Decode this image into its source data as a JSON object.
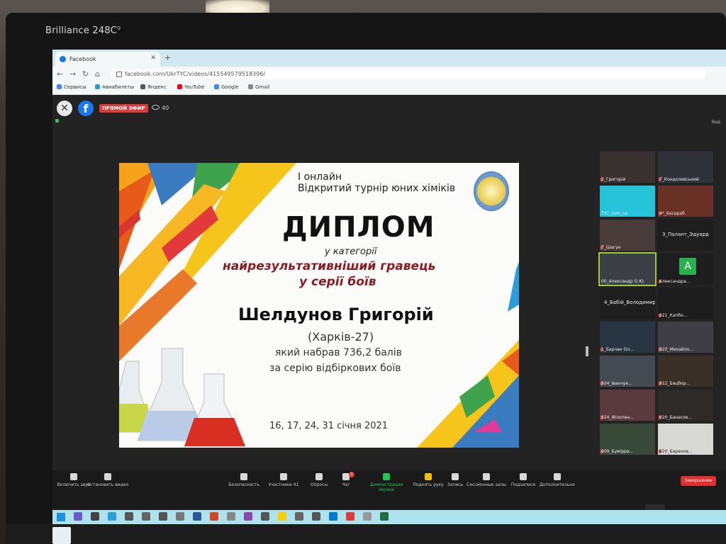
{
  "monitor": {
    "brand": "Brilliance 248C",
    "brand_sup": "Q"
  },
  "browser": {
    "tab_title": "Facebook",
    "url": "facebook.com/UkrTYC/videos/415549579518396/",
    "bookmarks": [
      {
        "label": "Сервисы",
        "color": "#4285f4"
      },
      {
        "label": "Авиабилеты",
        "color": "#2d9cdb"
      },
      {
        "label": "Яндекс",
        "color": "#555555"
      },
      {
        "label": "YouTube",
        "color": "#ff0000"
      },
      {
        "label": "Google",
        "color": "#4285f4"
      },
      {
        "label": "Gmail",
        "color": "#888888"
      }
    ]
  },
  "stream": {
    "live_label": "ПРЯМОЙ ЭФИР",
    "viewers": "40",
    "view_label": "Вид"
  },
  "diploma": {
    "line1": "І онлайн",
    "line2": "Відкритий турнір юних хіміків",
    "title": "ДИПЛОМ",
    "subtitle": "у категорії",
    "category_line1": "найрезультативніший гравець",
    "category_line2": "у серії боїв",
    "name": "Шелдунов Григорій",
    "city": "(Харків-27)",
    "score": "який набрав 736,2 балів",
    "series": "за серію відбіркових боїв",
    "dates": "16, 17, 24, 31 січня 2021"
  },
  "participants": [
    {
      "label": "3_Григорій",
      "style": "video"
    },
    {
      "label": "7_Кондолевський",
      "style": "video"
    },
    {
      "label": "TYC_com_ua",
      "style": "cyan"
    },
    {
      "label": "4*_Бесараб",
      "style": "video"
    },
    {
      "label": "7_Шагун",
      "style": "video"
    },
    {
      "label": "3_Палант_Эдуард",
      "style": "name"
    },
    {
      "label": "00_Александр О.Ю.",
      "style": "video"
    },
    {
      "label": "Александра...",
      "style": "avatar",
      "initial": "A"
    },
    {
      "label": "4_Бабій_Володимир",
      "style": "name"
    },
    {
      "label": "921_Капбо...",
      "style": "video"
    },
    {
      "label": "1_Барчан Ол...",
      "style": "video"
    },
    {
      "label": "920_Михайло...",
      "style": "video"
    },
    {
      "label": "924_Іванчук...",
      "style": "video"
    },
    {
      "label": "912_Бацбор...",
      "style": "video"
    },
    {
      "label": "924_Філопен...",
      "style": "video"
    },
    {
      "label": "920_Банасов...",
      "style": "video"
    },
    {
      "label": "909_Бумірра...",
      "style": "video"
    },
    {
      "label": "920_Баранов...",
      "style": "video"
    }
  ],
  "toolbar": {
    "unmute": "Включить звук",
    "video": "Остановить видео",
    "security": "Безопасность",
    "participants": "Участники",
    "participants_count": "41",
    "polls": "Опросы",
    "chat": "Чат",
    "chat_badge": "1",
    "share": "Демонстрация экрана",
    "raise_hand": "Поднять руку",
    "record": "Запись",
    "rooms": "Сессионные залы",
    "captions": "Подзаписи",
    "more": "Дополнительно",
    "end": "Завершение"
  },
  "colors": {
    "accent_red": "#e23a3a",
    "zoom_green": "#23c552",
    "fb_blue": "#1877f2",
    "category_text": "#8a1c23"
  }
}
